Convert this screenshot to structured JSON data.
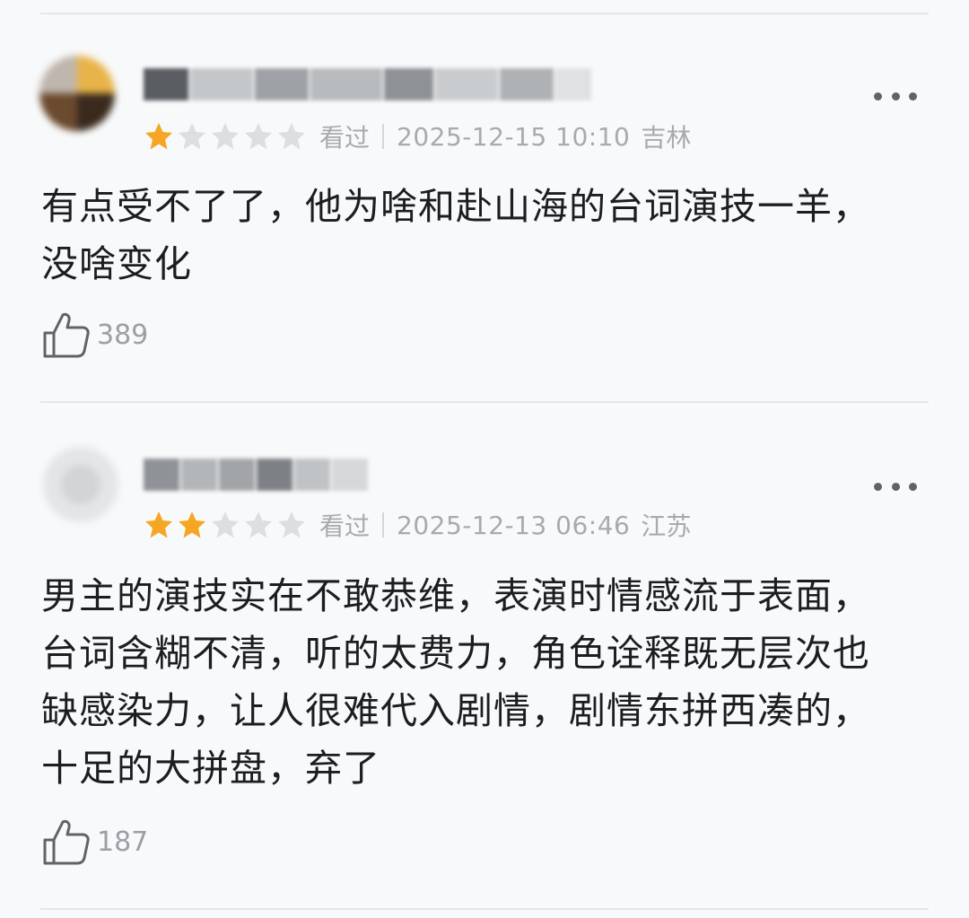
{
  "reviews": [
    {
      "stars": 1,
      "watched_label": "看过",
      "timestamp": "2025-12-15 10:10",
      "location": "吉林",
      "content_lines": [
        "有点受不了了，他为啥和赴山海的台词演技一羊，",
        "没啥变化"
      ],
      "likes": "389"
    },
    {
      "stars": 2,
      "watched_label": "看过",
      "timestamp": "2025-12-13 06:46",
      "location": "江苏",
      "content_lines": [
        "男主的演技实在不敢恭维，表演时情感流于表面，",
        "台词含糊不清，听的太费力，角色诠释既无层次也",
        "缺感染力，让人很难代入剧情，剧情东拼西凑的，",
        "十足的大拼盘，弃了"
      ],
      "likes": "187"
    }
  ],
  "colors": {
    "star_filled": "#f5a623",
    "star_empty": "#dcdfe2",
    "meta_text": "#a6abaf"
  },
  "icons": {
    "more": "more-horizontal-icon",
    "like": "thumbs-up-icon",
    "star": "star-icon"
  }
}
